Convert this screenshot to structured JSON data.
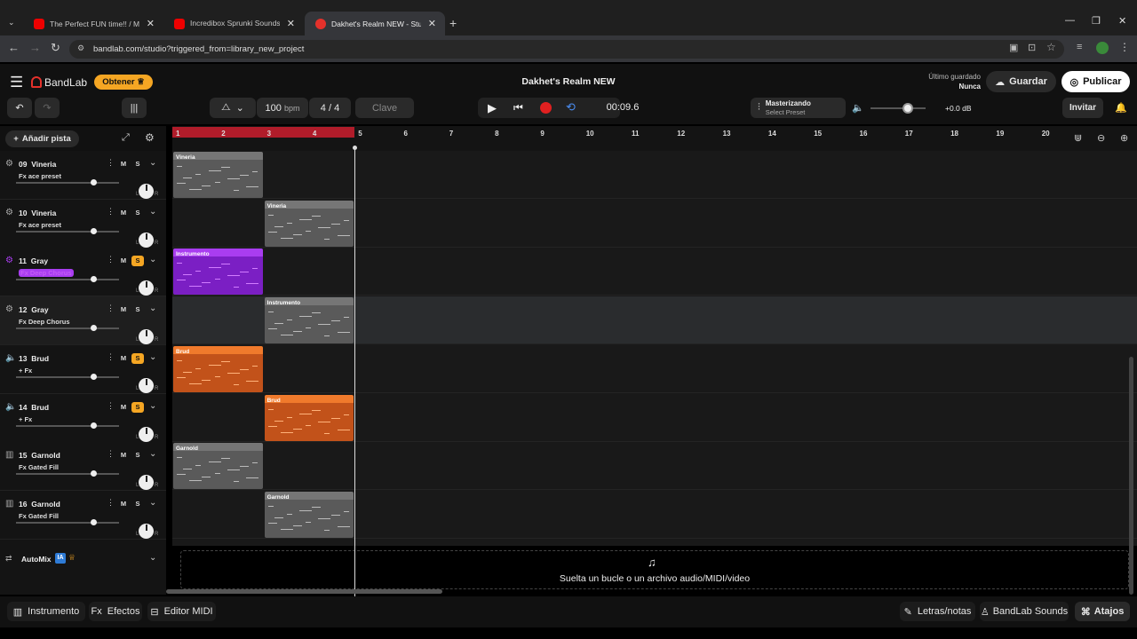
{
  "browser": {
    "tabs": [
      {
        "label": "The Perfect FUN time!! / My Pe",
        "icon": "youtube-icon"
      },
      {
        "label": "Incredibox Sprunki Sounds 🔊",
        "icon": "youtube-icon"
      },
      {
        "label": "Dakhet's Realm NEW - Studio",
        "icon": "bandlab-icon"
      }
    ],
    "url": "bandlab.com/studio?triggered_from=library_new_project"
  },
  "header": {
    "brand": "BandLab",
    "get_button": "Obtener",
    "project_title": "Dakhet's Realm NEW",
    "saved_label": "Último guardado",
    "saved_value": "Nunca",
    "save_button": "Guardar",
    "publish_button": "Publicar"
  },
  "transport": {
    "bpm_value": "100",
    "bpm_unit": "bpm",
    "time_sig_num": "4",
    "time_sig_sep": "/",
    "time_sig_den": "4",
    "key_button": "Clave",
    "time": "00:09.6",
    "mastering_title": "Masterizando",
    "mastering_sub": "Select Preset",
    "volume_db": "+0.0 dB",
    "invite_button": "Invitar"
  },
  "toolbar": {
    "add_track": "Añadir pista"
  },
  "ruler": {
    "bars": [
      "1",
      "2",
      "3",
      "4",
      "5",
      "6",
      "7",
      "8",
      "9",
      "10",
      "11",
      "12",
      "13",
      "14",
      "15",
      "16",
      "17",
      "18",
      "19",
      "20"
    ]
  },
  "tracks": [
    {
      "num": "09",
      "name": "Vineria",
      "fx": "Fx ace preset",
      "solo": false,
      "icon": "gear-icon",
      "clip": "Vineria",
      "color": "gray"
    },
    {
      "num": "10",
      "name": "Vineria",
      "fx": "Fx ace preset",
      "solo": false,
      "icon": "gear-icon",
      "clip": "Vineria",
      "color": "gray"
    },
    {
      "num": "11",
      "name": "Gray",
      "fx": "Fx Deep Chorus",
      "solo": true,
      "icon": "gear-icon",
      "clip": "Instrumento",
      "color": "purple"
    },
    {
      "num": "12",
      "name": "Gray",
      "fx": "Fx Deep Chorus",
      "solo": false,
      "icon": "gear-icon",
      "clip": "Instrumento",
      "color": "gray"
    },
    {
      "num": "13",
      "name": "Brud",
      "fx": "+ Fx",
      "solo": true,
      "icon": "drum-icon",
      "clip": "Brud",
      "color": "orange"
    },
    {
      "num": "14",
      "name": "Brud",
      "fx": "+ Fx",
      "solo": true,
      "icon": "drum-icon",
      "clip": "Brud",
      "color": "orange"
    },
    {
      "num": "15",
      "name": "Garnold",
      "fx": "Fx Gated Fill",
      "solo": false,
      "icon": "piano-icon",
      "clip": "Garnold",
      "color": "gray"
    },
    {
      "num": "16",
      "name": "Garnold",
      "fx": "Fx Gated Fill",
      "solo": false,
      "icon": "piano-icon",
      "clip": "Garnold",
      "color": "gray"
    }
  ],
  "mute_label": "M",
  "solo_label": "S",
  "knob_l": "L",
  "knob_r": "R",
  "automix": {
    "label": "AutoMix",
    "badge": "IA"
  },
  "dropzone": "Suelta un bucle o un archivo audio/MIDI/video",
  "bottom": {
    "instrument": "Instrumento",
    "effects": "Efectos",
    "midi_editor": "Editor MIDI",
    "lyrics": "Letras/notas",
    "sounds": "BandLab Sounds",
    "shortcuts": "Atajos"
  },
  "colors": {
    "accent": "#f5a623",
    "record": "#e02020",
    "purple": "#7b1fc4",
    "orange": "#c2521a",
    "gray": "#6a6a6a"
  }
}
